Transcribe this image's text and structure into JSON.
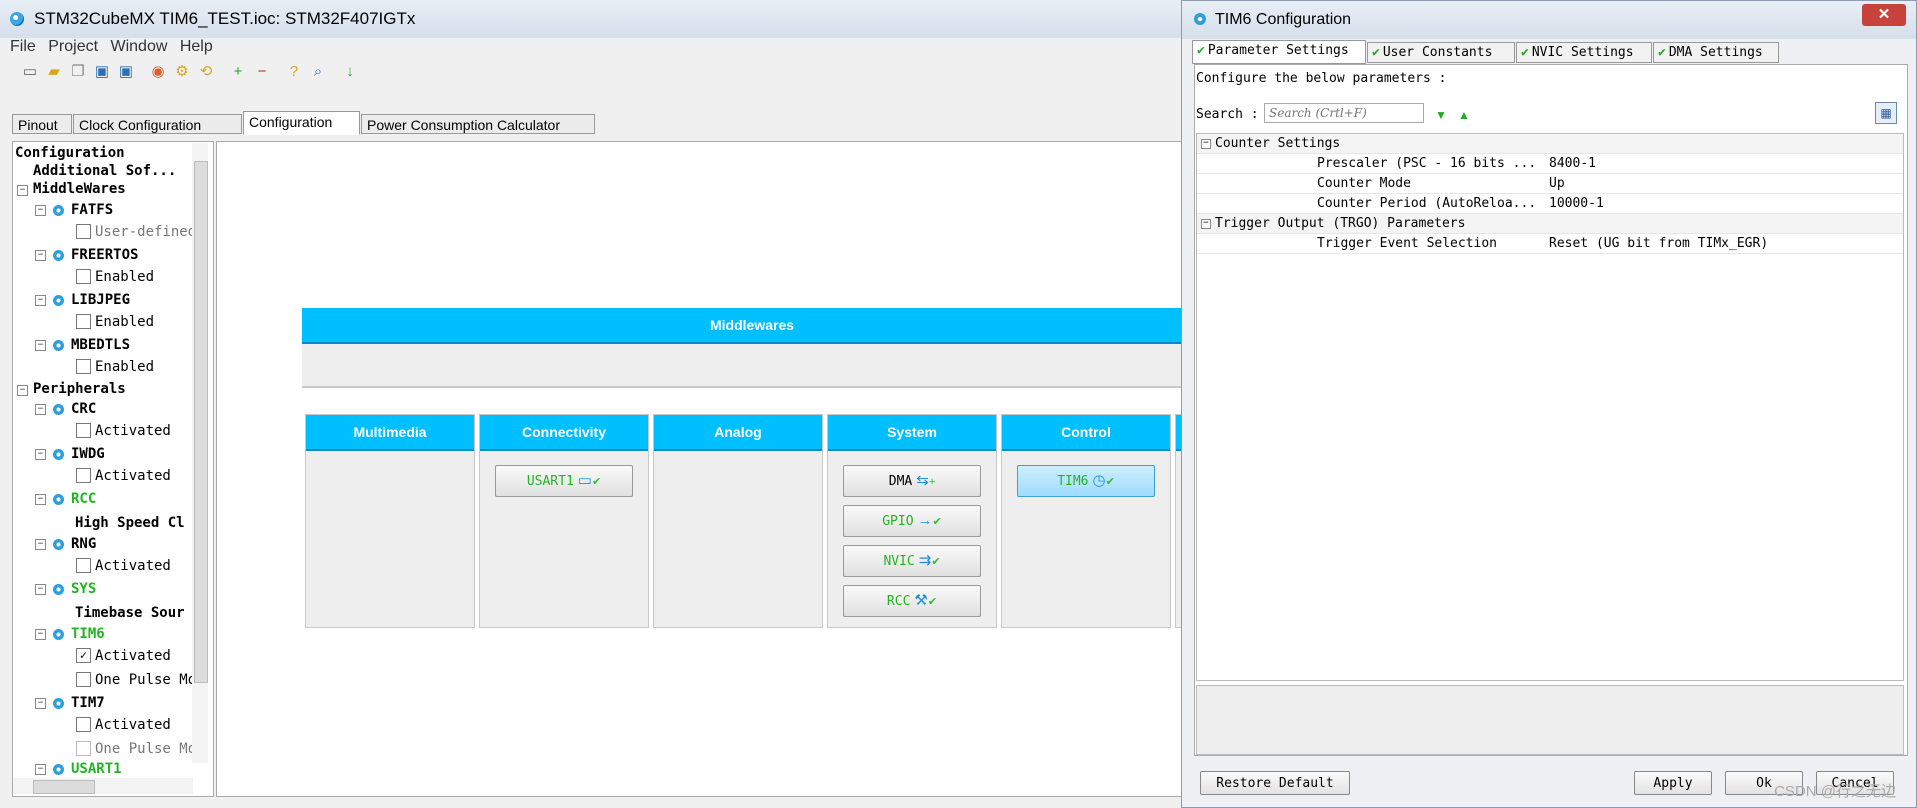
{
  "main_window": {
    "title": "STM32CubeMX TIM6_TEST.ioc: STM32F407IGTx",
    "menu": [
      "File",
      "Project",
      "Window",
      "Help"
    ],
    "tabs": [
      "Pinout",
      "Clock Configuration",
      "Configuration",
      "Power Consumption Calculator"
    ],
    "active_tab": "Configuration"
  },
  "tree": {
    "root": "Configuration",
    "additional": "Additional Sof...",
    "middlewares": "MiddleWares",
    "fatfs": "FATFS",
    "fatfs_child": "User-defined",
    "freertos": "FREERTOS",
    "freertos_child": "Enabled",
    "libjpeg": "LIBJPEG",
    "libjpeg_child": "Enabled",
    "mbedtls": "MBEDTLS",
    "mbedtls_child": "Enabled",
    "peripherals": "Peripherals",
    "crc": "CRC",
    "crc_child": "Activated",
    "iwdg": "IWDG",
    "iwdg_child": "Activated",
    "rcc": "RCC",
    "rcc_child": "High Speed Cl",
    "rng": "RNG",
    "rng_child": "Activated",
    "sys": "SYS",
    "sys_child": "Timebase Sour",
    "tim6": "TIM6",
    "tim6_child1": "Activated",
    "tim6_child2": "One Pulse Mo",
    "tim7": "TIM7",
    "tim7_child1": "Activated",
    "tim7_child2": "One Pulse Mo",
    "usart1": "USART1"
  },
  "canvas": {
    "middlewares_header": "Middlewares",
    "categories": {
      "multimedia": "Multimedia",
      "connectivity": "Connectivity",
      "analog": "Analog",
      "system": "System",
      "control": "Control"
    },
    "buttons": {
      "usart1": "USART1",
      "dma": "DMA",
      "gpio": "GPIO",
      "nvic": "NVIC",
      "rcc": "RCC",
      "tim6": "TIM6"
    }
  },
  "dialog": {
    "title": "TIM6 Configuration",
    "close": "✕",
    "tabs": [
      "Parameter Settings",
      "User Constants",
      "NVIC Settings",
      "DMA Settings"
    ],
    "configure_label": "Configure the below parameters :",
    "search_label": "Search :",
    "search_placeholder": "Search (Crtl+F)",
    "groups": {
      "counter": "Counter Settings",
      "trigger": "Trigger Output (TRGO) Parameters"
    },
    "params": [
      {
        "name": "Prescaler (PSC - 16 bits ...",
        "value": "8400-1"
      },
      {
        "name": "Counter Mode",
        "value": "Up"
      },
      {
        "name": "Counter Period (AutoReloa...",
        "value": "10000-1"
      },
      {
        "name": "Trigger Event Selection",
        "value": "Reset (UG bit from TIMx_EGR)"
      }
    ],
    "buttons": {
      "restore": "Restore Default",
      "apply": "Apply",
      "ok": "Ok",
      "cancel": "Cancel"
    }
  },
  "watermark": "CSDN @行之无边"
}
